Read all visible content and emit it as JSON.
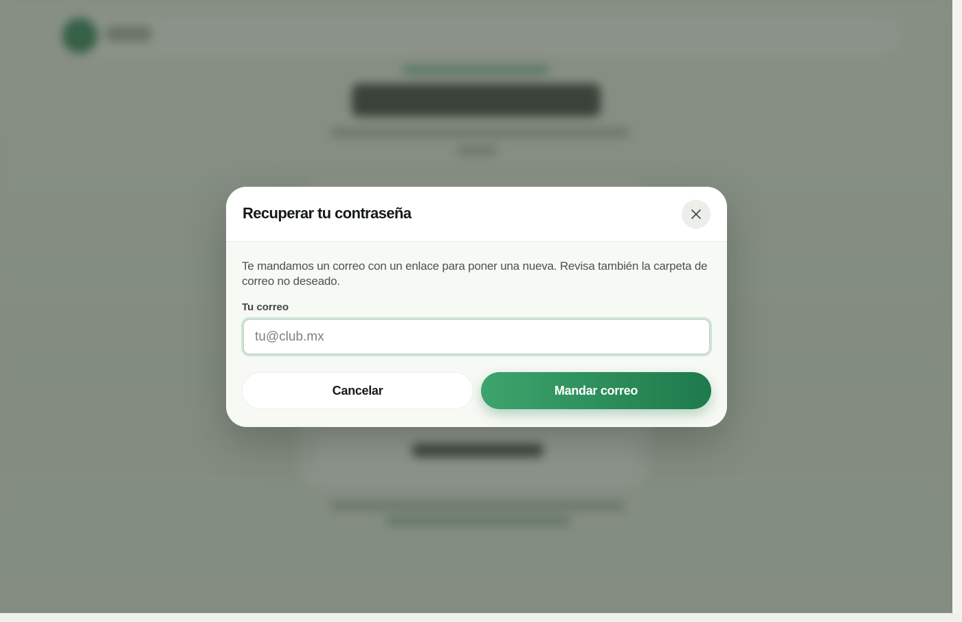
{
  "modal": {
    "title": "Recuperar tu contraseña",
    "description": "Te mandamos un correo con un enlace para poner una nueva. Revisa también la carpeta de correo no deseado.",
    "email_label": "Tu correo",
    "email_placeholder": "tu@club.mx",
    "email_value": "",
    "cancel_label": "Cancelar",
    "submit_label": "Mandar correo",
    "close_icon": "close-icon"
  },
  "colors": {
    "accent": "#1e7a4b",
    "accent_light": "#3da46d",
    "overlay": "#5a6458",
    "text_primary": "#141a15"
  }
}
